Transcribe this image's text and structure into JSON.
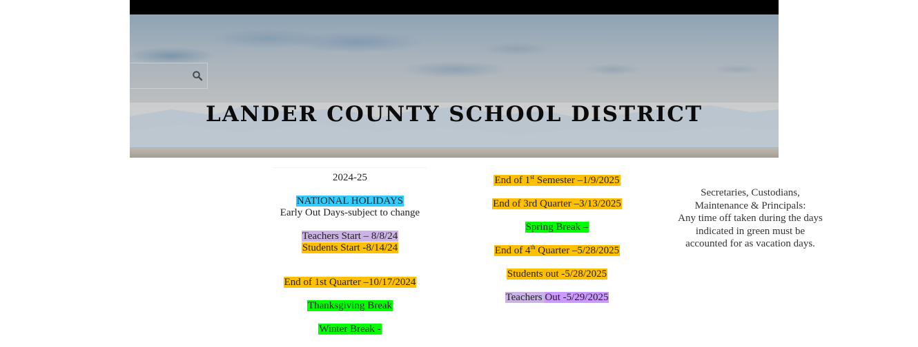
{
  "header": {
    "site_title": "LANDER COUNTY SCHOOL DISTRICT",
    "search": {
      "placeholder": "",
      "icon": "search-icon"
    }
  },
  "colors": {
    "national_holiday": "#33ccff",
    "teachers": "#ccb3e6",
    "quarter": "#ffc000",
    "break": "#00ff00",
    "teachers_out": "#cc99ff"
  },
  "calendar": {
    "year": "2024-25",
    "legend": {
      "national_holidays": "NATIONAL HOLIDAYS",
      "early_out": "Early Out Days-subject to change"
    },
    "left_column": {
      "teachers_start": "Teachers Start – 8/8/24",
      "students_start": "Students Start -8/14/24",
      "end_q1": "End of 1st Quarter –10/17/2024",
      "thanksgiving": "Thanksgiving Break",
      "winter_break": "Winter Break -"
    },
    "middle_column": {
      "end_semester_pre": "End of 1",
      "end_semester_sup": "st",
      "end_semester_post": " Semester –1/9/2025",
      "end_q3": "End of 3rd Quarter –3/13/2025",
      "spring_break": "Spring Break –",
      "end_q4_pre": "End of 4",
      "end_q4_sup": "th",
      "end_q4_post": " Quarter –5/28/2025",
      "students_out": "Students out -5/28/2025",
      "teachers_out_a": "Teachers ",
      "teachers_out_b": "Out -5/29/2025"
    },
    "notice": {
      "line1": "Secretaries, Custodians,",
      "line2": "Maintenance & Principals:",
      "line3": "Any time off taken during the days",
      "line4": "indicated in green must be",
      "line5": "accounted for as vacation days."
    }
  }
}
